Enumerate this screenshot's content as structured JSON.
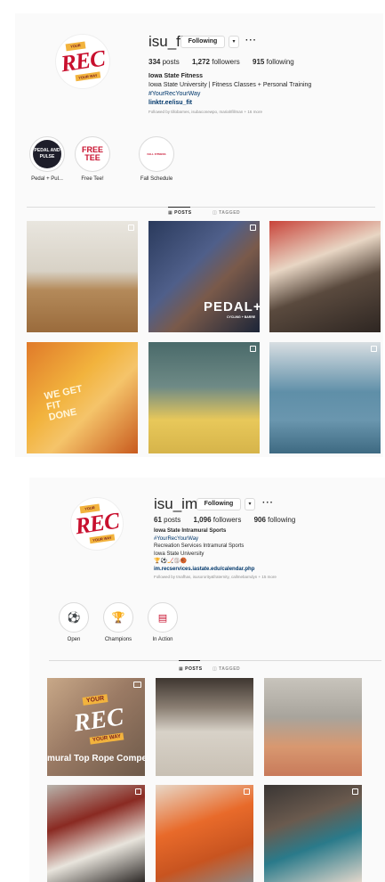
{
  "profile1": {
    "username": "isu_fit",
    "following_label": "Following",
    "dropdown_glyph": "▾",
    "more_glyph": "···",
    "logo": {
      "top": "YOUR",
      "main": "REC",
      "bottom": "YOUR WAY"
    },
    "stats": {
      "posts_count": "334",
      "posts_label": "posts",
      "followers_count": "1,272",
      "followers_label": "followers",
      "following_count": "915",
      "following_label": "following"
    },
    "bio": {
      "name": "Iowa State Fitness",
      "line1": "Iowa State University | Fitness Classes + Personal Training",
      "hashtag": "#YourRecYourWay",
      "link": "linktr.ee/isu_fit",
      "followed_by": "Followed by tillobarnes, isubaconewpo, mariahfillman + 16 more"
    },
    "highlights": [
      {
        "label": "Pedal + Pul...",
        "inner": "PEDAL AND PULSE"
      },
      {
        "label": "Free Tee!",
        "inner": "FREE TEE"
      },
      {
        "label": "Fall Schedule",
        "inner": "FALL FITNESS"
      }
    ],
    "tabs": {
      "posts": "POSTS",
      "tagged": "TAGGED",
      "posts_icon": "▦",
      "tagged_icon": "◫"
    },
    "grid_text": {
      "pedal": "PEDAL+",
      "pedal_sub": "CYCLING + BARRE",
      "shirt": "WE GET FIT DONE"
    }
  },
  "profile2": {
    "username": "isu_im",
    "following_label": "Following",
    "dropdown_glyph": "▾",
    "more_glyph": "···",
    "logo": {
      "top": "YOUR",
      "main": "REC",
      "bottom": "YOUR WAY"
    },
    "stats": {
      "posts_count": "61",
      "posts_label": "posts",
      "followers_count": "1,096",
      "followers_label": "followers",
      "following_count": "906",
      "following_label": "following"
    },
    "bio": {
      "name": "Iowa State Intramural Sports",
      "hashtag": "#YourRecYourWay",
      "line1": "Recreation Services Intramural Sports",
      "line2": "Iowa State University",
      "emojis": "🏆⚽🏒🏐🏀",
      "link": "im.recservices.iastate.edu/calendar.php",
      "followed_by": "Followed by tmafhas, isusorority&fraternity, callmebarndyn + 15 more"
    },
    "highlights": [
      {
        "label": "Open",
        "icon": "⚽"
      },
      {
        "label": "Champions",
        "icon": "🏆"
      },
      {
        "label": "In Action",
        "icon": "▤"
      }
    ],
    "tabs": {
      "posts": "POSTS",
      "tagged": "TAGGED",
      "posts_icon": "▦",
      "tagged_icon": "◫"
    },
    "grid_text": {
      "rec_top": "YOUR",
      "rec_main": "REC",
      "rec_bottom": "YOUR WAY",
      "caption": "mural Top Rope Compet"
    }
  },
  "colors": {
    "link": "#00376b",
    "brand_red": "#c8102e",
    "brand_gold": "#f2b33d"
  }
}
